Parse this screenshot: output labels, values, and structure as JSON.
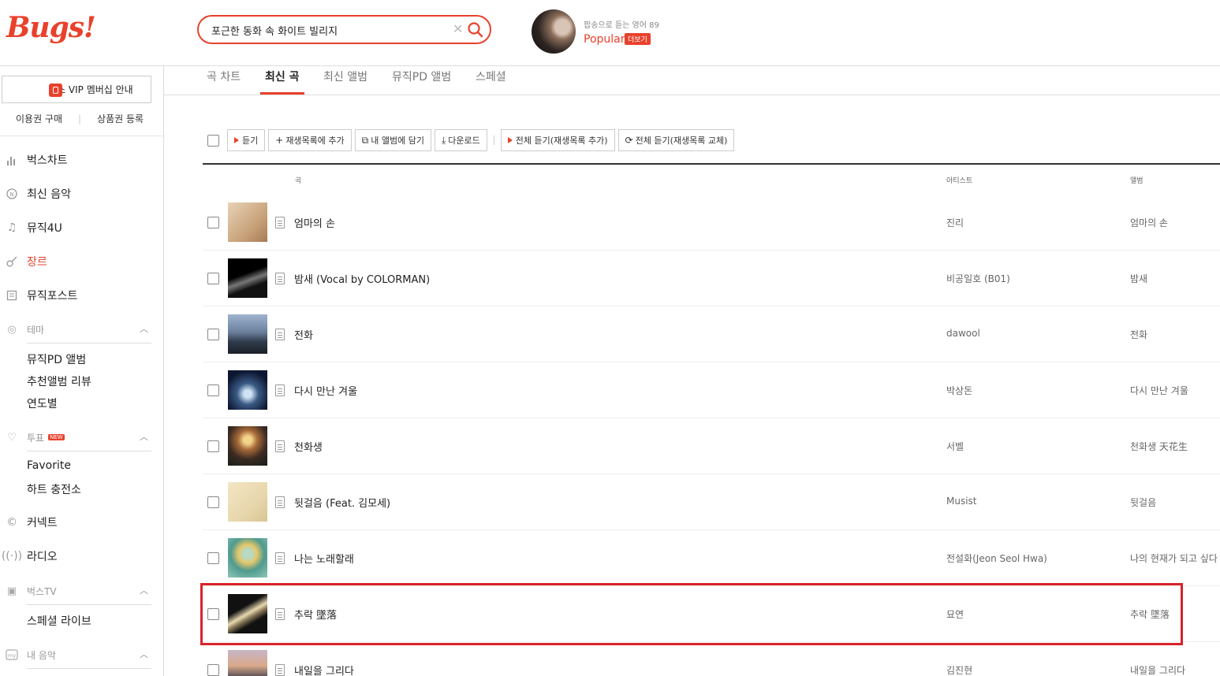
{
  "header": {
    "logo": "Bugs!",
    "search": {
      "value": "포근한 동화 속 화이트 빌리지",
      "placeholder": ""
    },
    "promo": {
      "subtitle": "팝송으로 듣는 영어 89",
      "title": "Popular",
      "more": "더보기"
    }
  },
  "sidebar": {
    "vip": "벅스 VIP 멤버십 안내",
    "links": [
      "이용권 구매",
      "상품권 등록"
    ],
    "nav": [
      {
        "label": "벅스차트",
        "icon": "chart-icon"
      },
      {
        "label": "최신 음악",
        "icon": "new-music-icon"
      },
      {
        "label": "뮤직4U",
        "icon": "note-icon"
      },
      {
        "label": "장르",
        "icon": "guitar-icon"
      },
      {
        "label": "뮤직포스트",
        "icon": "post-icon"
      }
    ],
    "theme": {
      "label": "테마",
      "items": [
        "뮤직PD 앨범",
        "추천앨범 리뷰",
        "연도별"
      ]
    },
    "vote": {
      "label": "투표",
      "badge": "NEW",
      "items": [
        "Favorite",
        "하트 충전소"
      ]
    },
    "more_nav": [
      {
        "label": "커넥트",
        "icon": "connect-icon"
      },
      {
        "label": "라디오",
        "icon": "radio-icon"
      }
    ],
    "tv": {
      "label": "벅스TV",
      "items": [
        "스페셜 라이브"
      ]
    },
    "my": {
      "label": "내 음악"
    }
  },
  "tabs": [
    "곡 차트",
    "최신 곡",
    "최신 앨범",
    "뮤직PD 앨범",
    "스페셜"
  ],
  "active_tab": "최신 곡",
  "toolbar": {
    "play": "듣기",
    "add_playlist": "재생목록에 추가",
    "add_album": "내 앨범에 담기",
    "download": "다운로드",
    "play_all_add": "전체 듣기(재생목록 추가)",
    "play_all_replace": "전체 듣기(재생목록 교체)"
  },
  "columns": {
    "song": "곡",
    "artist": "아티스트",
    "album": "앨범"
  },
  "songs": [
    {
      "title": "엄마의 손",
      "artist": "진리",
      "album": "엄마의 손"
    },
    {
      "title": "밤새 (Vocal by COLORMAN)",
      "artist": "비공일호 (B01)",
      "album": "밤새"
    },
    {
      "title": "전화",
      "artist": "dawool",
      "album": "전화"
    },
    {
      "title": "다시 만난 겨울",
      "artist": "박상돈",
      "album": "다시 만난 겨울"
    },
    {
      "title": "천화생",
      "artist": "서벨",
      "album": "천화생 天花生"
    },
    {
      "title": "뒷걸음 (Feat. 김모세)",
      "artist": "Musist",
      "album": "뒷걸음"
    },
    {
      "title": "나는 노래할래",
      "artist": "전설화(Jeon Seol Hwa)",
      "album": "나의 현재가 되고 싶다"
    },
    {
      "title": "추락 墜落",
      "artist": "묘연",
      "album": "추락 墜落"
    },
    {
      "title": "내일을 그리다",
      "artist": "김진현",
      "album": "내일을 그리다"
    }
  ],
  "colors": {
    "accent": "#e8412c",
    "highlight": "#d8232a"
  }
}
